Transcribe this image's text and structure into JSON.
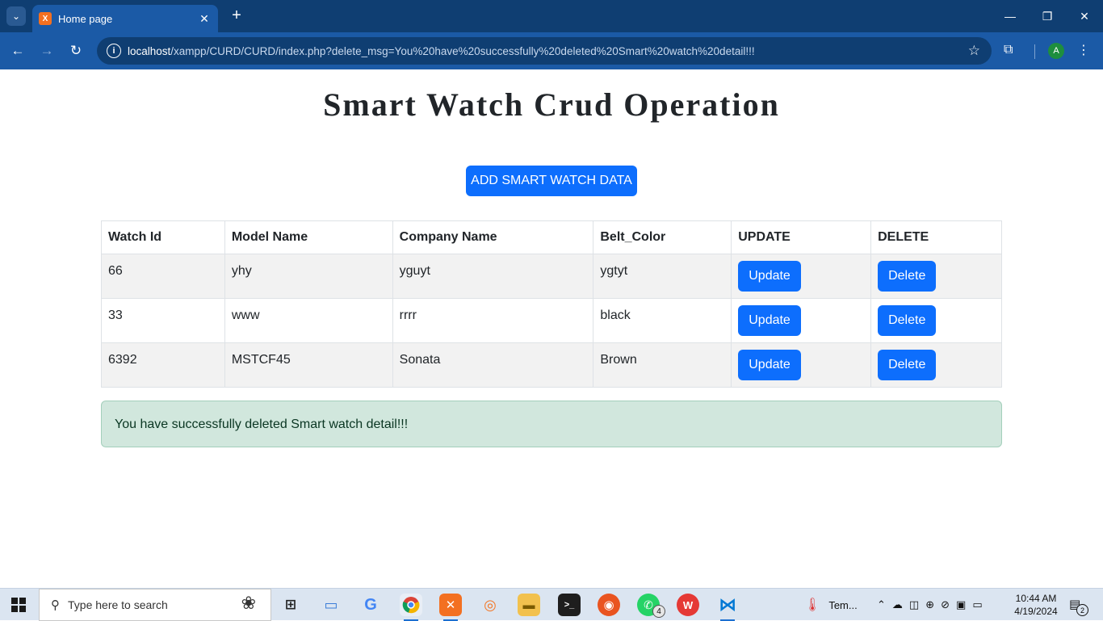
{
  "browser": {
    "tab_title": "Home page",
    "favicon_label": "X",
    "tab_close": "✕",
    "new_tab": "+",
    "url_host": "localhost",
    "url_path": "/xampp/CURD/CURD/index.php?delete_msg=You%20have%20successfully%20deleted%20Smart%20watch%20detail!!!",
    "profile_initial": "A",
    "icons": {
      "tab_search": "chevron-down-icon",
      "back": "back-arrow-icon",
      "forward": "forward-arrow-icon",
      "reload": "reload-icon",
      "site_info": "info-icon",
      "bookmark": "star-icon",
      "extensions": "puzzle-icon",
      "menu": "kebab-menu-icon"
    }
  },
  "page": {
    "title": "Smart Watch Crud Operation",
    "add_button": "ADD SMART WATCH DATA",
    "table": {
      "headers": [
        "Watch Id",
        "Model Name",
        "Company Name",
        "Belt_Color",
        "UPDATE",
        "DELETE"
      ],
      "rows": [
        {
          "id": "66",
          "model": "yhy",
          "company": "yguyt",
          "color": "ygtyt",
          "update": "Update",
          "delete": "Delete"
        },
        {
          "id": "33",
          "model": "www",
          "company": "rrrr",
          "color": "black",
          "update": "Update",
          "delete": "Delete"
        },
        {
          "id": "6392",
          "model": "MSTCF45",
          "company": "Sonata",
          "color": "Brown",
          "update": "Update",
          "delete": "Delete"
        }
      ]
    },
    "alert_message": "You have successfully deleted Smart watch detail!!!",
    "colors": {
      "primary": "#0d6efd",
      "alert_bg": "#d1e7dd",
      "alert_text": "#0a3622",
      "browser_frame": "#1b5aa6"
    }
  },
  "taskbar": {
    "search_placeholder": "Type here to search",
    "weather_label": "Tem...",
    "whatsapp_badge": "4",
    "notification_count": "2",
    "time": "10:44 AM",
    "date": "4/19/2024"
  }
}
